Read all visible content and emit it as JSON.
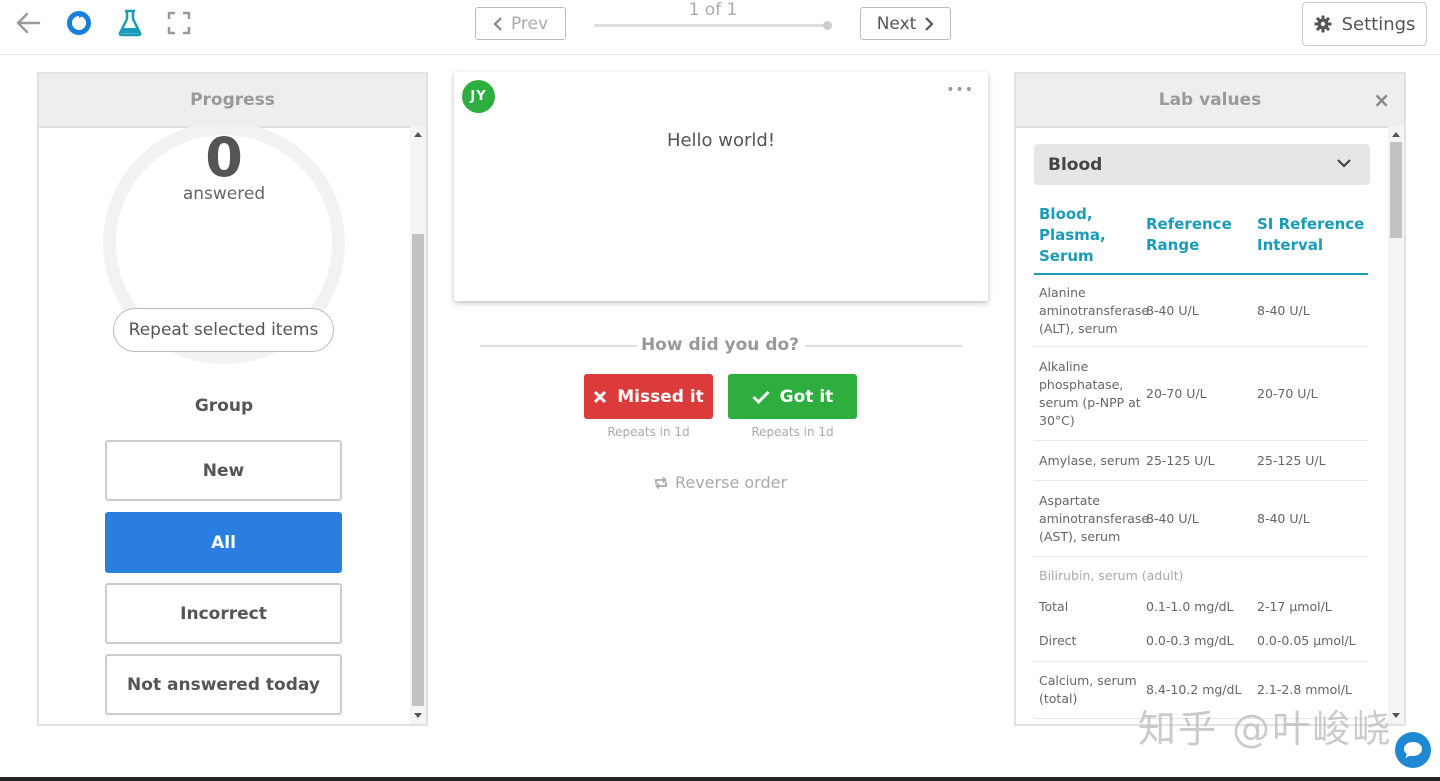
{
  "nav": {
    "prev_label": "Prev",
    "next_label": "Next",
    "counter": "1 of 1",
    "settings_label": "Settings"
  },
  "progress": {
    "title": "Progress",
    "answered_count": "0",
    "answered_label": "answered",
    "repeat_button": "Repeat selected items",
    "group_title": "Group",
    "groups": [
      "New",
      "All",
      "Incorrect",
      "Not answered today"
    ],
    "active_group": "All"
  },
  "card": {
    "avatar": "JY",
    "text": "Hello world!"
  },
  "review": {
    "prompt": "How did you do?",
    "missed_label": "Missed it",
    "got_label": "Got it",
    "missed_repeat": "Repeats in 1d",
    "got_repeat": "Repeats in 1d",
    "reverse_label": "Reverse order"
  },
  "lab": {
    "title": "Lab values",
    "selected": "Blood",
    "headers": [
      "Blood, Plasma, Serum",
      "Reference Range",
      "SI Reference Interval"
    ],
    "rows": [
      {
        "name": "Alanine aminotransferase (ALT), serum",
        "ref": "8-40 U/L",
        "si": "8-40 U/L"
      },
      {
        "name": "Alkaline phosphatase, serum (p-NPP at 30°C)",
        "ref": "20-70 U/L",
        "si": "20-70 U/L"
      },
      {
        "name": "Amylase, serum",
        "ref": "25-125 U/L",
        "si": "25-125 U/L"
      },
      {
        "name": "Aspartate aminotransferase (AST), serum",
        "ref": "8-40 U/L",
        "si": "8-40 U/L"
      }
    ],
    "bilirubin_label": "Bilirubin, serum (adult)",
    "bilirubin_rows": [
      {
        "name": "Total",
        "ref": "0.1-1.0 mg/dL",
        "si": "2-17 μmol/L"
      },
      {
        "name": "Direct",
        "ref": "0.0-0.3 mg/dL",
        "si": "0.0-0.05 μmol/L"
      }
    ],
    "calcium": {
      "name": "Calcium, serum (total)",
      "ref": "8.4-10.2 mg/dL",
      "si": "2.1-2.8 mmol/L"
    }
  },
  "watermark": "知乎 @叶峻峣",
  "colors": {
    "primary": "#2a7ee0",
    "missed": "#db3b3b",
    "got": "#2eae3e",
    "lab_accent": "#1a9cb8"
  }
}
